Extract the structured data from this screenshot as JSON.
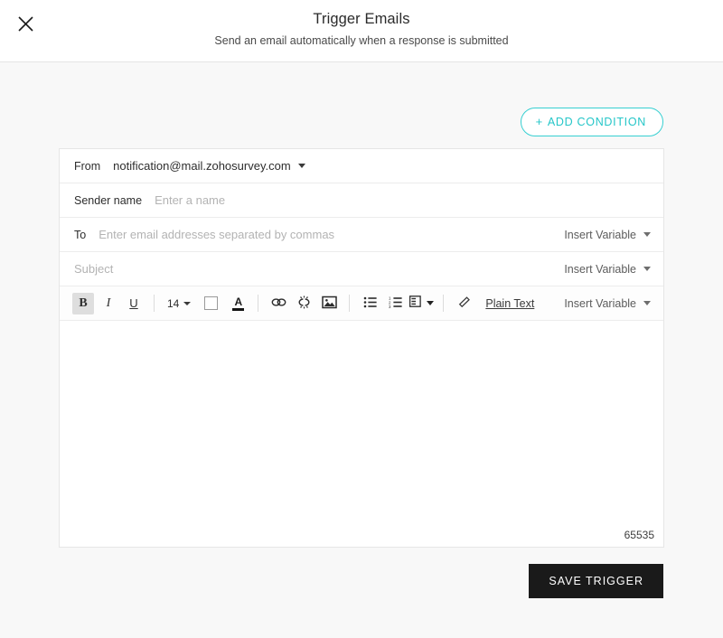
{
  "header": {
    "close_icon": "close-icon",
    "title": "Trigger Emails",
    "subtitle": "Send an email automatically when a response is submitted"
  },
  "condition": {
    "plus": "+",
    "label": "ADD CONDITION"
  },
  "form": {
    "from": {
      "label": "From",
      "value": "notification@mail.zohosurvey.com"
    },
    "sender_name": {
      "label": "Sender name",
      "placeholder": "Enter a name",
      "value": ""
    },
    "to": {
      "label": "To",
      "placeholder": "Enter email addresses separated by commas",
      "value": "",
      "insert_variable": "Insert Variable"
    },
    "subject": {
      "placeholder": "Subject",
      "value": "",
      "insert_variable": "Insert Variable"
    }
  },
  "toolbar": {
    "bold": "B",
    "italic": "I",
    "underline": "U",
    "font_size": "14",
    "background_color": "#ffffff",
    "text_color": "A",
    "link_icon": "link-icon",
    "unlink_icon": "unlink-icon",
    "image_icon": "image-icon",
    "bullet_list_icon": "bulleted-list-icon",
    "numbered_list_icon": "numbered-list-icon",
    "align_icon": "text-align-icon",
    "eraser_icon": "clear-formatting-icon",
    "plain_text": "Plain Text",
    "insert_variable": "Insert Variable"
  },
  "editor": {
    "content": "",
    "char_count": "65535"
  },
  "footer": {
    "save_label": "SAVE TRIGGER"
  },
  "colors": {
    "accent": "#25c6c8",
    "save_bg": "#1a1a1a",
    "page_bg": "#f8f8f8",
    "card_bg": "#ffffff"
  }
}
